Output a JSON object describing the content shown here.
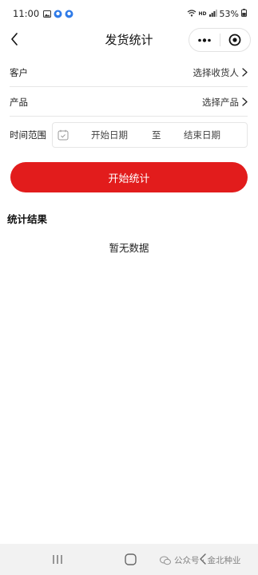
{
  "status_bar": {
    "time": "11:00",
    "battery": "53%",
    "network": "HD"
  },
  "nav": {
    "title": "发货统计",
    "more_icon": "more-dots-icon",
    "close_icon": "target-circle-icon"
  },
  "form": {
    "customer": {
      "label": "客户",
      "value": "选择收货人"
    },
    "product": {
      "label": "产品",
      "value": "选择产品"
    },
    "time_range": {
      "label": "时间范围",
      "start_placeholder": "开始日期",
      "separator": "至",
      "end_placeholder": "结束日期"
    },
    "submit_label": "开始统计"
  },
  "result": {
    "title": "统计结果",
    "empty": "暂无数据"
  },
  "watermark": "公众号 · 金北种业",
  "colors": {
    "accent": "#e21c1c",
    "divider": "#e6e6e6",
    "bottom_bar": "#f2f2f2"
  }
}
